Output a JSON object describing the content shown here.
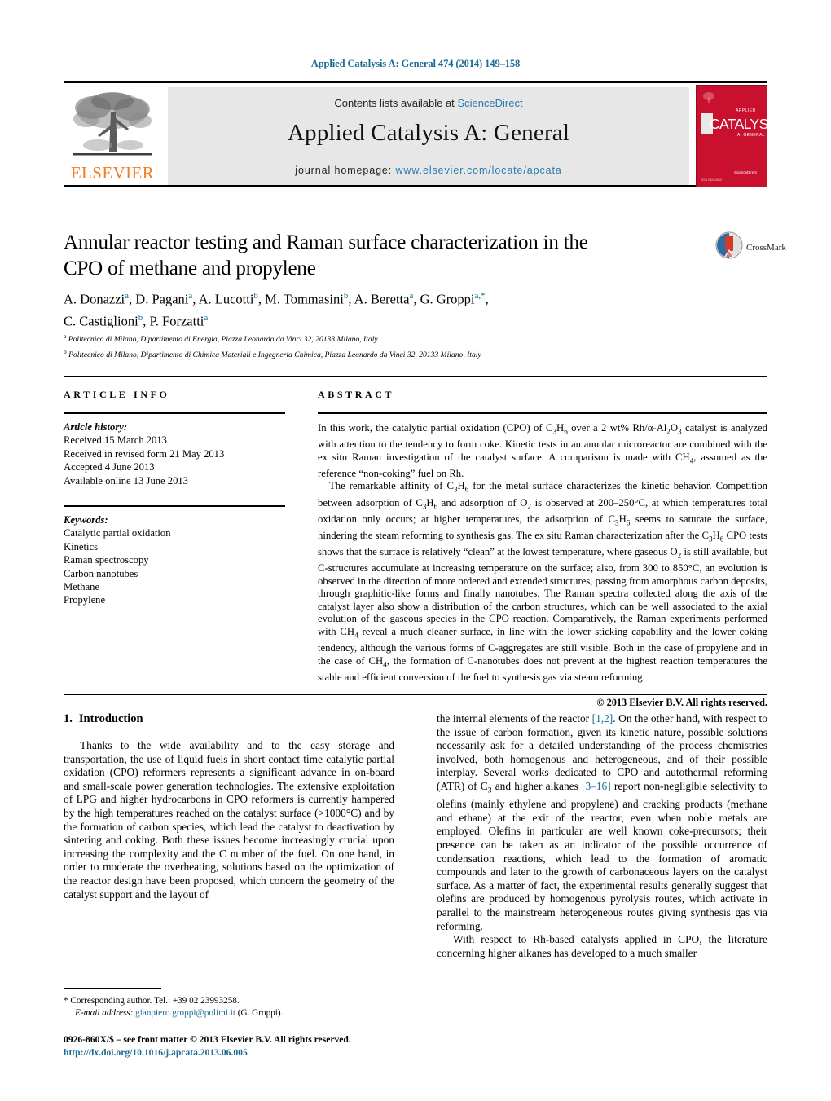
{
  "running_head": "Applied Catalysis A: General 474 (2014) 149–158",
  "masthead": {
    "contents_prefix": "Contents lists available at ",
    "sciencedirect": "ScienceDirect",
    "journal_title": "Applied Catalysis A: General",
    "homepage_prefix": "journal homepage: ",
    "homepage_url": "www.elsevier.com/locate/apcata",
    "publisher": "ELSEVIER",
    "cover_word": "CATALYSIS",
    "cover_sub_top": "APPLIED",
    "cover_sub_bottom": "A: GENERAL",
    "cover_footer": "Available online at\nScienceDirect",
    "accent_blue": "#2a7ab0",
    "elsevier_orange": "#f57c1f",
    "cover_red": "#c9112f"
  },
  "article": {
    "title": "Annular reactor testing and Raman surface characterization in the CPO of methane and propylene",
    "crossmark_label": "CrossMark",
    "authors_line_1": "A. Donazzi<sup>a</sup>, D. Pagani<sup>a</sup>, A. Lucotti<sup>b</sup>, M. Tommasini<sup>b</sup>, A. Beretta<sup>a</sup>, G. Groppi<sup>a,<span>*</span></sup>,",
    "authors_line_2": "C. Castiglioni<sup>b</sup>, P. Forzatti<sup>a</sup>",
    "affiliation_a": "<sup>a</sup> Politecnico di Milano, Dipartimento di Energia, Piazza Leonardo da Vinci 32, 20133 Milano, Italy",
    "affiliation_b": "<sup>b</sup> Politecnico di Milano, Dipartimento di Chimica Materiali e Ingegneria Chimica, Piazza Leonardo da Vinci 32, 20133 Milano, Italy"
  },
  "article_info": {
    "heading": "ARTICLE INFO",
    "history_label": "Article history:",
    "history": [
      "Received 15 March 2013",
      "Received in revised form 21 May 2013",
      "Accepted 4 June 2013",
      "Available online 13 June 2013"
    ],
    "keywords_label": "Keywords:",
    "keywords": [
      "Catalytic partial oxidation",
      "Kinetics",
      "Raman spectroscopy",
      "Carbon nanotubes",
      "Methane",
      "Propylene"
    ]
  },
  "abstract": {
    "heading": "ABSTRACT",
    "paragraph_1": "In this work, the catalytic partial oxidation (CPO) of C<sub>3</sub>H<sub>6</sub> over a 2 wt% Rh/&#945;-Al<sub>2</sub>O<sub>3</sub> catalyst is analyzed with attention to the tendency to form coke. Kinetic tests in an annular microreactor are combined with the ex situ Raman investigation of the catalyst surface. A comparison is made with CH<sub>4</sub>, assumed as the reference &#8220;non-coking&#8221; fuel on Rh.",
    "paragraph_2": "The remarkable affinity of C<sub>3</sub>H<sub>6</sub> for the metal surface characterizes the kinetic behavior. Competition between adsorption of C<sub>3</sub>H<sub>6</sub> and adsorption of O<sub>2</sub> is observed at 200&#8211;250&#176;C, at which temperatures total oxidation only occurs; at higher temperatures, the adsorption of C<sub>3</sub>H<sub>6</sub> seems to saturate the surface, hindering the steam reforming to synthesis gas. The ex situ Raman characterization after the C<sub>3</sub>H<sub>6</sub> CPO tests shows that the surface is relatively &#8220;clean&#8221; at the lowest temperature, where gaseous O<sub>2</sub> is still available, but C-structures accumulate at increasing temperature on the surface; also, from 300 to 850&#176;C, an evolution is observed in the direction of more ordered and extended structures, passing from amorphous carbon deposits, through graphitic-like forms and finally nanotubes. The Raman spectra collected along the axis of the catalyst layer also show a distribution of the carbon structures, which can be well associated to the axial evolution of the gaseous species in the CPO reaction. Comparatively, the Raman experiments performed with CH<sub>4</sub> reveal a much cleaner surface, in line with the lower sticking capability and the lower coking tendency, although the various forms of C-aggregates are still visible. Both in the case of propylene and in the case of CH<sub>4</sub>, the formation of C-nanotubes does not prevent at the highest reaction temperatures the stable and efficient conversion of the fuel to synthesis gas via steam reforming.",
    "copyright": "&#169; 2013 Elsevier B.V. All rights reserved."
  },
  "introduction": {
    "number": "1.",
    "heading": "Introduction",
    "left_paragraph": "Thanks to the wide availability and to the easy storage and transportation, the use of liquid fuels in short contact time catalytic partial oxidation (CPO) reformers represents a significant advance in on-board and small-scale power generation technologies. The extensive exploitation of LPG and higher hydrocarbons in CPO reformers is currently hampered by the high temperatures reached on the catalyst surface (&gt;1000&#176;C) and by the formation of carbon species, which lead the catalyst to deactivation by sintering and coking. Both these issues become increasingly crucial upon increasing the complexity and the C number of the fuel. On one hand, in order to moderate the overheating, solutions based on the optimization of the reactor design have been proposed, which concern the geometry of the catalyst support and the layout of",
    "right_paragraph_1": "the internal elements of the reactor <span class=\"ref\">[1,2]</span>. On the other hand, with respect to the issue of carbon formation, given its kinetic nature, possible solutions necessarily ask for a detailed understanding of the process chemistries involved, both homogenous and heterogeneous, and of their possible interplay. Several works dedicated to CPO and autothermal reforming (ATR) of C<sub>3</sub> and higher alkanes <span class=\"ref\">[3&#8211;16]</span> report non-negligible selectivity to olefins (mainly ethylene and propylene) and cracking products (methane and ethane) at the exit of the reactor, even when noble metals are employed. Olefins in particular are well known coke-precursors; their presence can be taken as an indicator of the possible occurrence of condensation reactions, which lead to the formation of aromatic compounds and later to the growth of carbonaceous layers on the catalyst surface. As a matter of fact, the experimental results generally suggest that olefins are produced by homogenous pyrolysis routes, which activate in parallel to the mainstream heterogeneous routes giving synthesis gas via reforming.",
    "right_paragraph_2": "With respect to Rh-based catalysts applied in CPO, the literature concerning higher alkanes has developed to a much smaller"
  },
  "footnote": {
    "marker": "*",
    "corresponding": "Corresponding author. Tel.: +39 02 23993258.",
    "email_label": "E-mail address:",
    "email": "gianpiero.groppi@polimi.it",
    "email_owner": "(G. Groppi)."
  },
  "imprint": {
    "issn_line": "0926-860X/$ &#8211; see front matter &#169; 2013 Elsevier B.V. All rights reserved.",
    "doi": "http://dx.doi.org/10.1016/j.apcata.2013.06.005"
  }
}
